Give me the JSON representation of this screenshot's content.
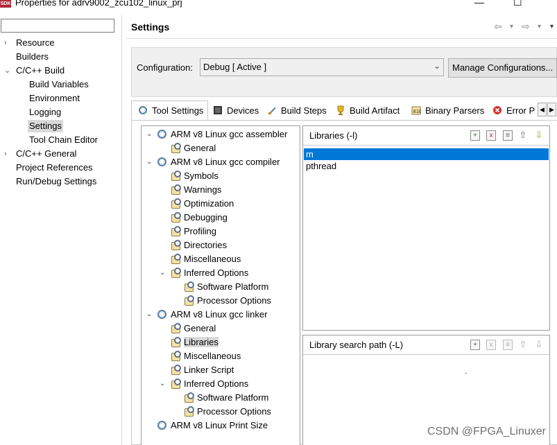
{
  "window": {
    "icon_label": "SDK",
    "title": "Properties for adrv9002_zcu102_linux_prj",
    "minimize": "—",
    "maximize": "☐"
  },
  "filter": {
    "value": ""
  },
  "nav": [
    {
      "label": "Resource",
      "toggle": "›"
    },
    {
      "label": "Builders"
    },
    {
      "label": "C/C++ Build",
      "toggle": "⌄"
    },
    {
      "label": "Build Variables"
    },
    {
      "label": "Environment"
    },
    {
      "label": "Logging"
    },
    {
      "label": "Settings",
      "selected": true
    },
    {
      "label": "Tool Chain Editor"
    },
    {
      "label": "C/C++ General",
      "toggle": "›"
    },
    {
      "label": "Project References"
    },
    {
      "label": "Run/Debug Settings"
    }
  ],
  "header": {
    "title": "Settings",
    "back": "⇦",
    "forward": "⇨",
    "menu": "▾"
  },
  "config": {
    "label": "Configuration:",
    "selected": "Debug  [ Active ]",
    "manage_label": "Manage Configurations..."
  },
  "tabs": [
    {
      "label": "Tool Settings",
      "icon": "tool-settings-icon",
      "active": true
    },
    {
      "label": "Devices",
      "icon": "devices-icon"
    },
    {
      "label": "Build Steps",
      "icon": "build-steps-icon"
    },
    {
      "label": "Build Artifact",
      "icon": "build-artifact-icon"
    },
    {
      "label": "Binary Parsers",
      "icon": "binary-parsers-icon"
    },
    {
      "label": "Error P",
      "icon": "error-parsers-icon"
    }
  ],
  "tab_scroll": {
    "left": "◀",
    "right": "▶"
  },
  "tree": [
    {
      "label": "ARM v8 Linux gcc assembler",
      "level": 0,
      "toggle": "⌄",
      "icon": "gear"
    },
    {
      "label": "General",
      "level": 1,
      "icon": "opt"
    },
    {
      "label": "ARM v8 Linux gcc compiler",
      "level": 0,
      "toggle": "⌄",
      "icon": "gear"
    },
    {
      "label": "Symbols",
      "level": 1,
      "icon": "opt"
    },
    {
      "label": "Warnings",
      "level": 1,
      "icon": "opt"
    },
    {
      "label": "Optimization",
      "level": 1,
      "icon": "opt"
    },
    {
      "label": "Debugging",
      "level": 1,
      "icon": "opt"
    },
    {
      "label": "Profiling",
      "level": 1,
      "icon": "opt"
    },
    {
      "label": "Directories",
      "level": 1,
      "icon": "opt"
    },
    {
      "label": "Miscellaneous",
      "level": 1,
      "icon": "opt"
    },
    {
      "label": "Inferred Options",
      "level": 1,
      "toggle": "⌄",
      "icon": "opt"
    },
    {
      "label": "Software Platform",
      "level": 2,
      "icon": "opt"
    },
    {
      "label": "Processor Options",
      "level": 2,
      "icon": "opt"
    },
    {
      "label": "ARM v8 Linux gcc linker",
      "level": 0,
      "toggle": "⌄",
      "icon": "gear"
    },
    {
      "label": "General",
      "level": 1,
      "icon": "opt"
    },
    {
      "label": "Libraries",
      "level": 1,
      "icon": "opt",
      "selected": true
    },
    {
      "label": "Miscellaneous",
      "level": 1,
      "icon": "opt"
    },
    {
      "label": "Linker Script",
      "level": 1,
      "icon": "opt"
    },
    {
      "label": "Inferred Options",
      "level": 1,
      "toggle": "⌄",
      "icon": "opt"
    },
    {
      "label": "Software Platform",
      "level": 2,
      "icon": "opt"
    },
    {
      "label": "Processor Options",
      "level": 2,
      "icon": "opt"
    },
    {
      "label": "ARM v8 Linux Print Size",
      "level": 0,
      "icon": "gear"
    }
  ],
  "libraries": {
    "title": "Libraries (-l)",
    "items": [
      {
        "label": "m",
        "selected": true
      },
      {
        "label": "pthread"
      }
    ],
    "tools": {
      "add": "+",
      "delete": "x",
      "edit": "≡",
      "up": "⇧",
      "down": "⇩"
    }
  },
  "search_path": {
    "title": "Library search path (-L)",
    "items": [],
    "tools": {
      "add": "+",
      "delete": "x",
      "edit": "≡",
      "up": "⇧",
      "down": "⇩"
    },
    "dot": "."
  },
  "watermark": "CSDN @FPGA_Linuxer"
}
